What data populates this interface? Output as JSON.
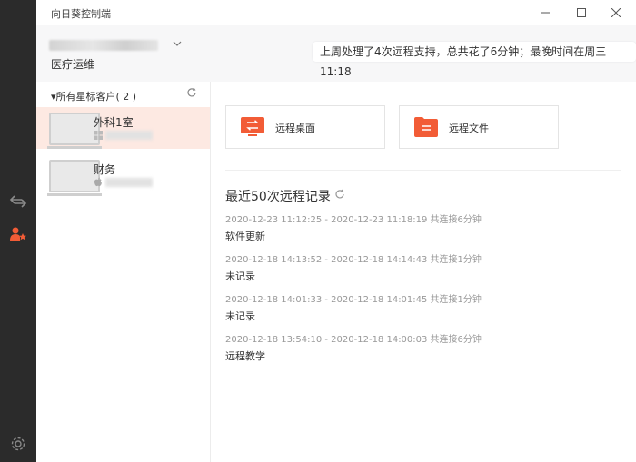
{
  "app": {
    "title": "向日葵控制端"
  },
  "header": {
    "account_name": "医疗运维",
    "summary": "上周处理了4次远程支持，总共花了6分钟；最晚时间在周三 11:18"
  },
  "sidebar": {
    "group_label": "▾所有星标客户( 2 )",
    "devices": [
      {
        "name": "外科1室",
        "os": "windows",
        "selected": true
      },
      {
        "name": "财务",
        "os": "apple",
        "selected": false
      }
    ]
  },
  "actions": {
    "remote_desktop": "远程桌面",
    "remote_files": "远程文件"
  },
  "records": {
    "title": "最近50次远程记录",
    "items": [
      {
        "time": "2020-12-23 11:12:25 - 2020-12-23 11:18:19 共连接6分钟",
        "desc": "软件更新"
      },
      {
        "time": "2020-12-18 14:13:52 - 2020-12-18 14:14:43 共连接1分钟",
        "desc": "未记录"
      },
      {
        "time": "2020-12-18 14:01:33 - 2020-12-18 14:01:45 共连接1分钟",
        "desc": "未记录"
      },
      {
        "time": "2020-12-18 13:54:10 - 2020-12-18 14:00:03 共连接6分钟",
        "desc": "远程教学"
      }
    ]
  },
  "colors": {
    "accent": "#f25c36",
    "rail": "#2b2b2b",
    "selected_row": "#fde9e2"
  }
}
